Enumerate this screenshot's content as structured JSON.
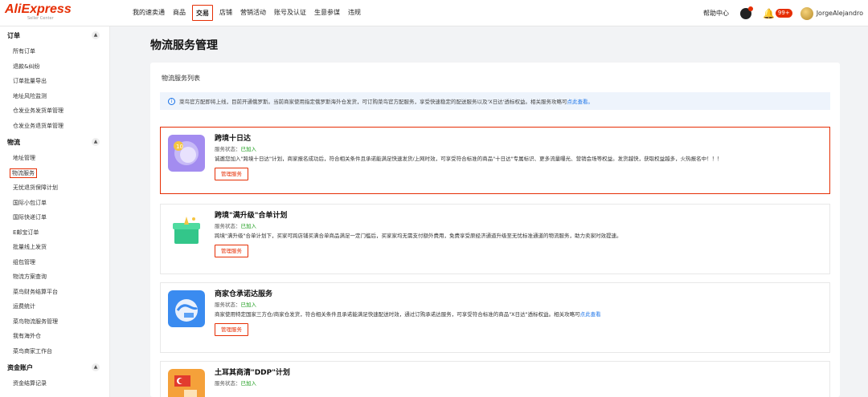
{
  "header": {
    "logo": "AliExpress",
    "logo_sub": "Seller Center",
    "nav": [
      "我的速卖通",
      "商品",
      "交易",
      "店铺",
      "营销活动",
      "账号及认证",
      "生意参谋",
      "违规"
    ],
    "help": "帮助中心",
    "badge": "99+",
    "username": "JorgeAlejandro"
  },
  "sidebar": {
    "sections": [
      {
        "title": "订单",
        "items": [
          "所有订单",
          "退款&纠纷",
          "订单批量导出",
          "地址风险监测",
          "仓发业务发货单管理",
          "仓发业务退货单管理"
        ]
      },
      {
        "title": "物流",
        "items": [
          "地址管理",
          "物流服务",
          "无忧退货保障计划",
          "国际小包订单",
          "国际快递订单",
          "E邮宝订单",
          "批量线上发货",
          "组包管理",
          "物流方案查询",
          "菜鸟财务结算平台",
          "运费统计",
          "菜鸟物流服务管理",
          "我有海外仓",
          "菜鸟商家工作台"
        ]
      },
      {
        "title": "资金账户",
        "items": [
          "资金结算记录"
        ]
      }
    ]
  },
  "main": {
    "page_title": "物流服务管理",
    "panel_title": "物流服务列表",
    "notice": {
      "text": "菜鸟官方配即将上线，目前开通俄罗斯。当前商家使用指定俄罗斯海外仓发货，可订购菜鸟官方配服务，享受快速稳定的配送服务以及'X日达'透标权益。相关服务攻略可",
      "link": "点此查看。"
    },
    "services": [
      {
        "title": "跨境十日达",
        "status_label": "服务状态：",
        "status_value": "已加入",
        "desc": "诚邀您加入\"跨境十日达\"计划，商家报名成功后，符合相关条件且承诺能满足快速发货/上网时效，可享受符合标准的商品\"十日达\"专属标识、更多流量曝光、营销会场等权益。发货越快，获取权益越多，火热报名中！！！",
        "desc_link": "",
        "button": "管理服务"
      },
      {
        "title": "跨境\"满升级\"合单计划",
        "status_label": "服务状态：",
        "status_value": "已加入",
        "desc": "跨境\"满升级\"合单计划下，买家可跨店铺买满合单商品满足一定门槛后，买家家均无需支付额外费用，免费享受原经济通道升级至无忧标准通道的物流服务，助力卖家时效提速。",
        "desc_link": "",
        "button": "管理服务"
      },
      {
        "title": "商家仓承诺达服务",
        "status_label": "服务状态：",
        "status_value": "已加入",
        "desc": "商家使用特定国家三方仓/商家仓发货，符合相关条件且承诺能满足快速配送时效，通过订购承诺达服务，可享受符合标准的商品\"X日达\"透标权益。相关攻略可",
        "desc_link": "点此查看",
        "button": "管理服务"
      },
      {
        "title": "土耳其商清\"DDP\"计划",
        "status_label": "服务状态：",
        "status_value": "已加入",
        "desc": "",
        "desc_link": "",
        "button": ""
      }
    ]
  },
  "colors": {
    "brand": "#e62e04",
    "link": "#1a73e8",
    "success": "#1c9c1c"
  }
}
